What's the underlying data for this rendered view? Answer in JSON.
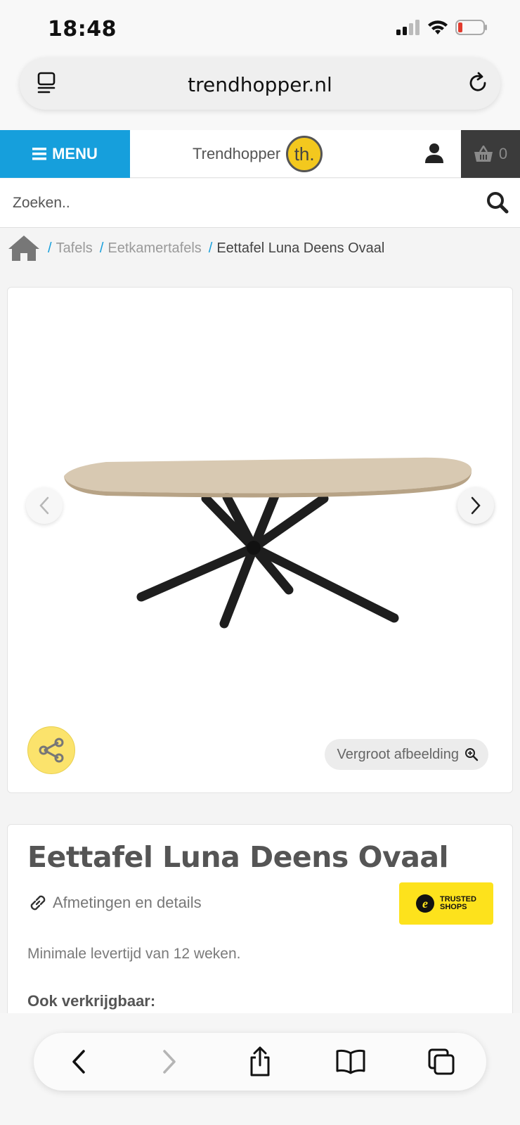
{
  "status_bar": {
    "time": "18:48"
  },
  "browser": {
    "url": "trendhopper.nl"
  },
  "header": {
    "menu_label": "MENU",
    "logo_text": "Trendhopper",
    "logo_badge": "th.",
    "cart_count": "0"
  },
  "search": {
    "placeholder": "Zoeken.."
  },
  "breadcrumb": {
    "items": [
      "Tafels",
      "Eetkamertafels"
    ],
    "current": "Eettafel Luna Deens Ovaal"
  },
  "gallery": {
    "zoom_label": "Vergroot afbeelding"
  },
  "product": {
    "title": "Eettafel Luna Deens Ovaal",
    "details_link": "Afmetingen en details",
    "trusted_badge": "TRUSTED SHOPS",
    "delivery": "Minimale levertijd van 12 weken.",
    "also_available": "Ook verkrijgbaar:"
  },
  "colors": {
    "menu_blue": "#169fdc",
    "logo_yellow": "#f3c81e",
    "cart_dark": "#3b3b3b",
    "trusted_yellow": "#fde21c"
  }
}
